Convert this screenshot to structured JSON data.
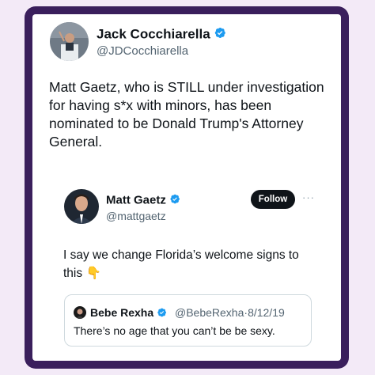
{
  "tweet": {
    "author_name": "Jack Cocchiarella",
    "author_handle": "@JDCocchiarella",
    "body": "Matt Gaetz, who is STILL under investigation for having s*x with minors, has been nominated to be Donald Trump's Attorney General."
  },
  "reply": {
    "author_name": "Matt Gaetz",
    "author_handle": "@mattgaetz",
    "follow_label": "Follow",
    "more_label": "···",
    "body": "I say we change Florida’s welcome signs to this",
    "emoji": "👇"
  },
  "quoted": {
    "author_name": "Bebe Rexha",
    "author_handle": "@BebeRexha",
    "separator": "·",
    "date": "8/12/19",
    "body": "There’s no age that you can’t be be sexy."
  },
  "icons": {
    "verified": "verified-badge-icon",
    "more": "more-options-icon",
    "pointing_down": "pointing-down-emoji-icon"
  },
  "colors": {
    "frame": "#3a1f5c",
    "background": "#f3eaf7",
    "verified": "#1d9bf0",
    "follow_button": "#0f1419"
  }
}
